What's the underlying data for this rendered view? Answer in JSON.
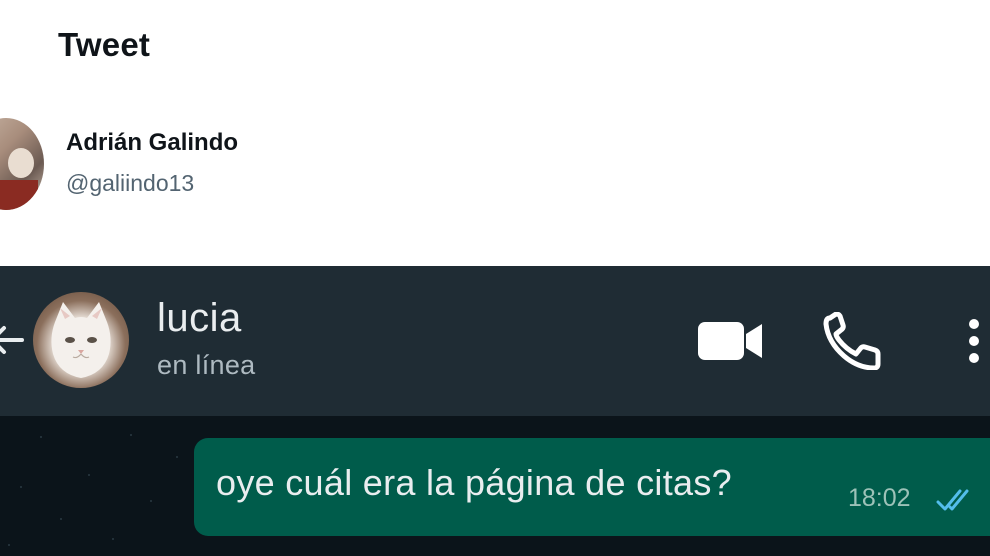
{
  "tweet": {
    "title": "Tweet",
    "author": {
      "name": "Adrián Galindo",
      "handle": "@galiindo13"
    }
  },
  "chat_header": {
    "contact_name": "lucia",
    "status": "en línea",
    "icons": [
      "back-arrow-icon",
      "video-call-icon",
      "voice-call-icon",
      "more-options-icon"
    ]
  },
  "messages": [
    {
      "direction": "outgoing",
      "text": "oye cuál era la página de citas?",
      "time": "18:02",
      "status": "read"
    }
  ],
  "colors": {
    "header_bg": "#1f2c34",
    "chat_bg": "#0b141a",
    "outgoing_bubble": "#005c4b",
    "read_ticks": "#53bdeb"
  }
}
